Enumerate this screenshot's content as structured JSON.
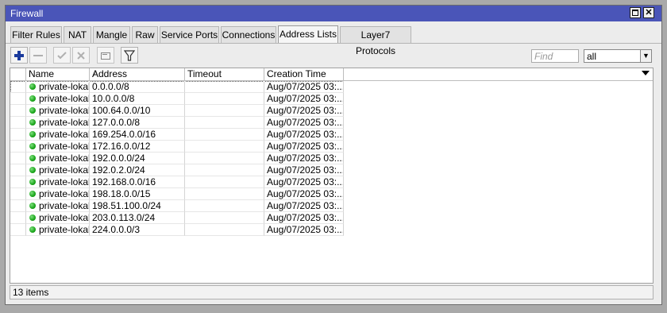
{
  "window": {
    "title": "Firewall"
  },
  "tabs": [
    {
      "label": "Filter Rules",
      "active": false
    },
    {
      "label": "NAT",
      "active": false
    },
    {
      "label": "Mangle",
      "active": false
    },
    {
      "label": "Raw",
      "active": false
    },
    {
      "label": "Service Ports",
      "active": false
    },
    {
      "label": "Connections",
      "active": false
    },
    {
      "label": "Address Lists",
      "active": true
    },
    {
      "label": "Layer7 Protocols",
      "active": false
    }
  ],
  "toolbar": {
    "add_icon": "plus-icon",
    "remove_icon": "minus-icon",
    "enable_icon": "check-icon",
    "disable_icon": "x-icon",
    "comment_icon": "comment-icon",
    "filter_icon": "filter-icon",
    "find_placeholder": "Find",
    "filter_select_value": "all"
  },
  "table": {
    "columns": [
      "Name",
      "Address",
      "Timeout",
      "Creation Time"
    ],
    "rows": [
      {
        "name": "private-lokal",
        "address": "0.0.0.0/8",
        "timeout": "",
        "created": "Aug/07/2025 03:..."
      },
      {
        "name": "private-lokal",
        "address": "10.0.0.0/8",
        "timeout": "",
        "created": "Aug/07/2025 03:..."
      },
      {
        "name": "private-lokal",
        "address": "100.64.0.0/10",
        "timeout": "",
        "created": "Aug/07/2025 03:..."
      },
      {
        "name": "private-lokal",
        "address": "127.0.0.0/8",
        "timeout": "",
        "created": "Aug/07/2025 03:..."
      },
      {
        "name": "private-lokal",
        "address": "169.254.0.0/16",
        "timeout": "",
        "created": "Aug/07/2025 03:..."
      },
      {
        "name": "private-lokal",
        "address": "172.16.0.0/12",
        "timeout": "",
        "created": "Aug/07/2025 03:..."
      },
      {
        "name": "private-lokal",
        "address": "192.0.0.0/24",
        "timeout": "",
        "created": "Aug/07/2025 03:..."
      },
      {
        "name": "private-lokal",
        "address": "192.0.2.0/24",
        "timeout": "",
        "created": "Aug/07/2025 03:..."
      },
      {
        "name": "private-lokal",
        "address": "192.168.0.0/16",
        "timeout": "",
        "created": "Aug/07/2025 03:..."
      },
      {
        "name": "private-lokal",
        "address": "198.18.0.0/15",
        "timeout": "",
        "created": "Aug/07/2025 03:..."
      },
      {
        "name": "private-lokal",
        "address": "198.51.100.0/24",
        "timeout": "",
        "created": "Aug/07/2025 03:..."
      },
      {
        "name": "private-lokal",
        "address": "203.0.113.0/24",
        "timeout": "",
        "created": "Aug/07/2025 03:..."
      },
      {
        "name": "private-lokal",
        "address": "224.0.0.0/3",
        "timeout": "",
        "created": "Aug/07/2025 03:..."
      }
    ]
  },
  "status": {
    "items_text": "13 items"
  },
  "colors": {
    "titlebar": "#4a55b8",
    "status_dot": "#1aa61a"
  }
}
